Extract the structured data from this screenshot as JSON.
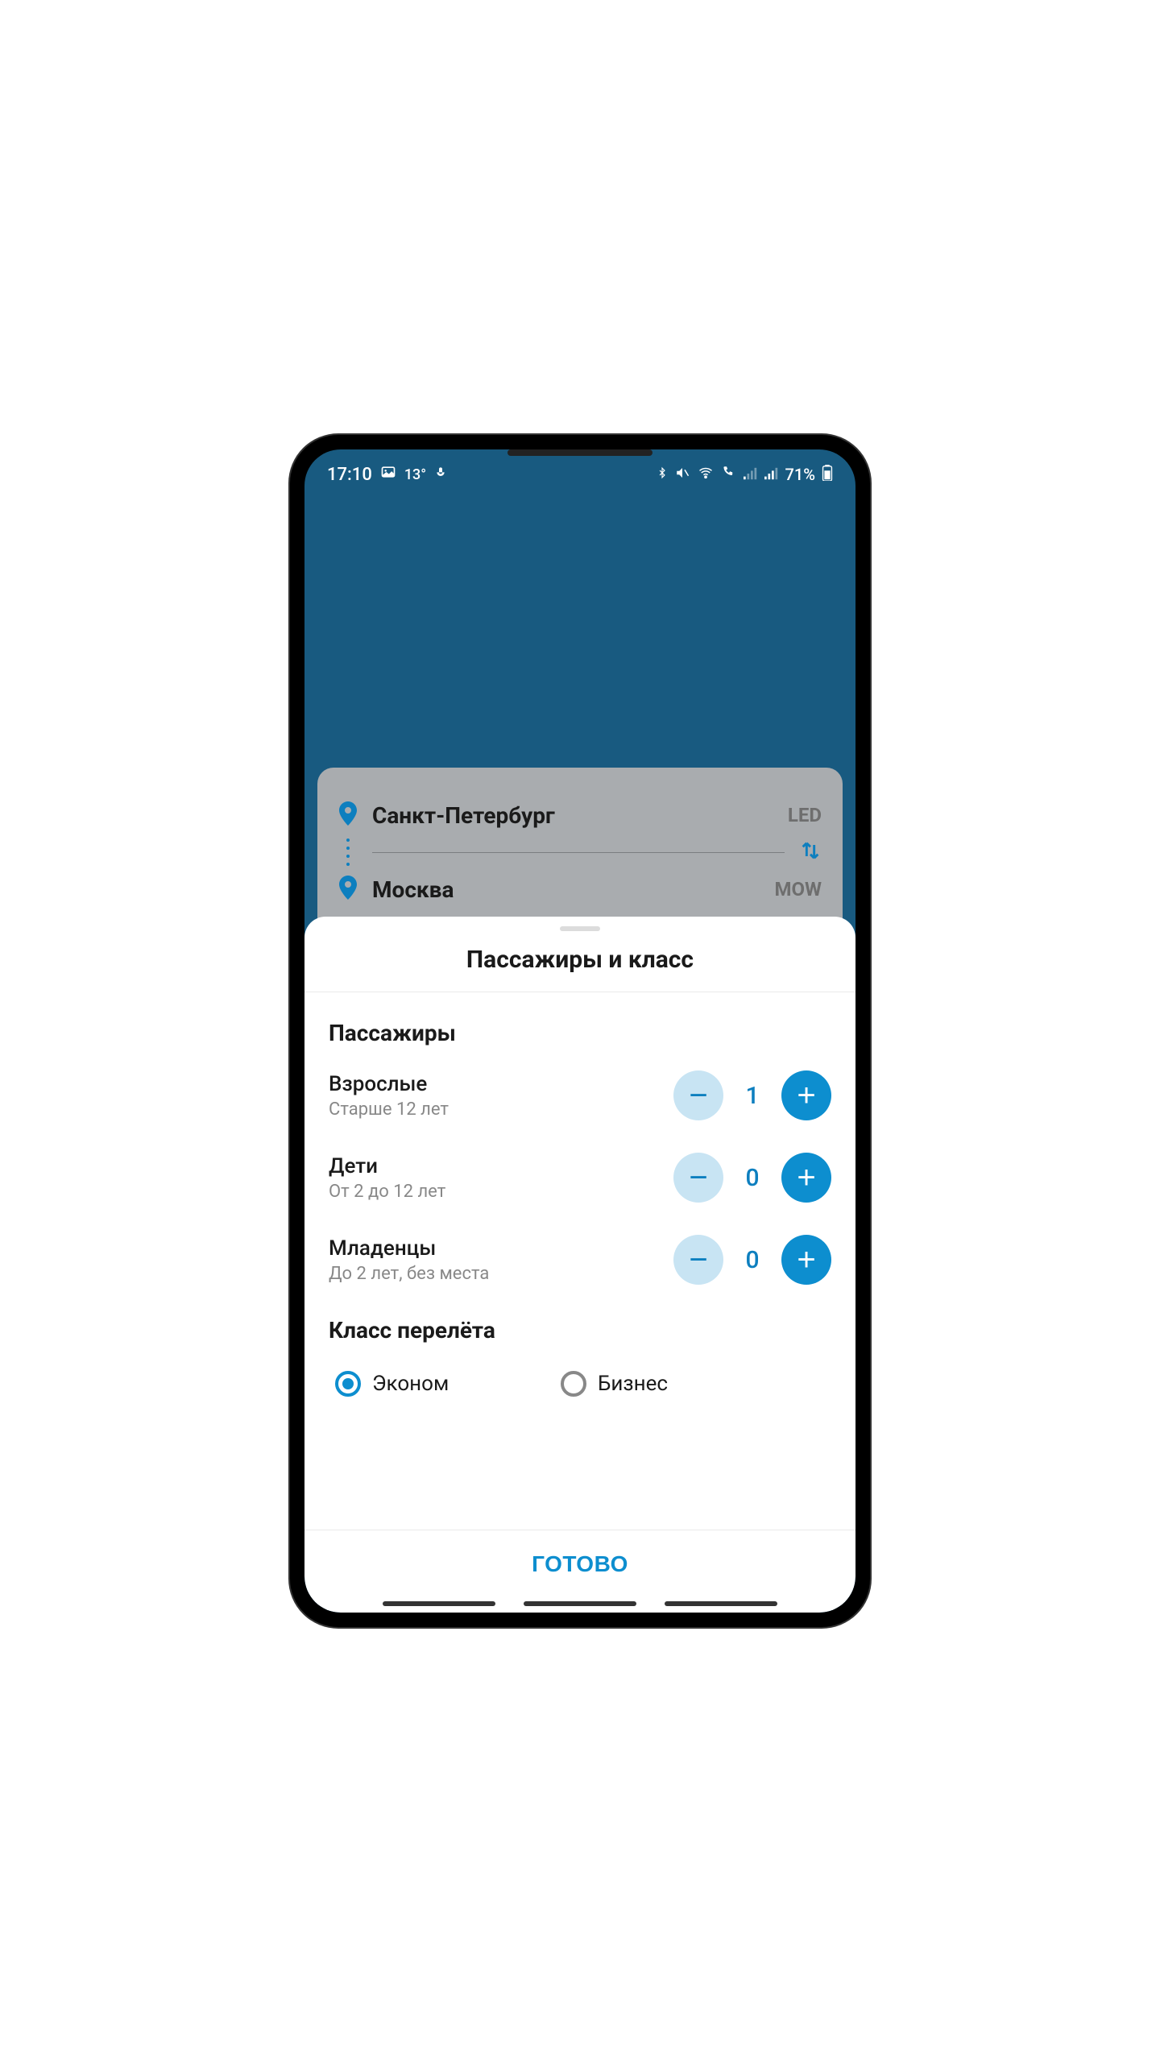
{
  "status": {
    "time": "17:10",
    "temp": "13°",
    "battery": "71%"
  },
  "route": {
    "from_city": "Санкт-Петербург",
    "from_code": "LED",
    "to_city": "Москва",
    "to_code": "MOW"
  },
  "sheet": {
    "title": "Пассажиры и класс",
    "passengers_heading": "Пассажиры",
    "rows": {
      "adults": {
        "label": "Взрослые",
        "sub": "Старше 12 лет",
        "value": "1"
      },
      "children": {
        "label": "Дети",
        "sub": "От 2 до 12 лет",
        "value": "0"
      },
      "infants": {
        "label": "Младенцы",
        "sub": "До 2 лет, без места",
        "value": "0"
      }
    },
    "class_heading": "Класс перелёта",
    "class_options": {
      "economy": "Эконом",
      "business": "Бизнес"
    },
    "done": "ГОТОВО"
  }
}
